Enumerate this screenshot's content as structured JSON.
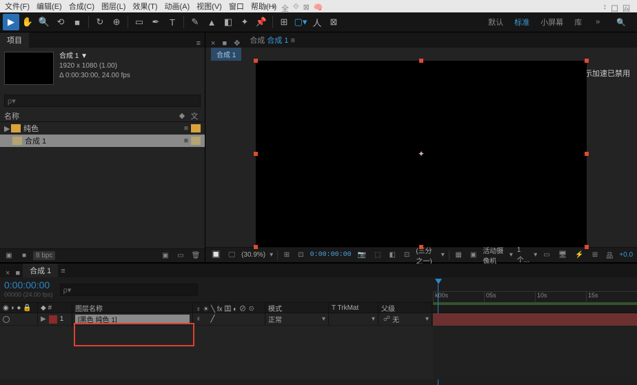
{
  "menu": {
    "file": "文件(F)",
    "edit": "编辑(E)",
    "composition": "合成(C)",
    "layer": "图层(L)",
    "effect": "效果(T)",
    "animation": "动画(A)",
    "view": "视图(V)",
    "window": "窗口",
    "help": "帮助(H)"
  },
  "workspace": {
    "default": "默认",
    "standard": "标准",
    "small": "小屏幕",
    "library": "库"
  },
  "project": {
    "tab": "项目",
    "item_name": "合成 1 ▼",
    "resolution": "1920 x 1080 (1.00)",
    "duration": "Δ 0:00:30:00, 24.00 fps",
    "search_placeholder": "ρ▾",
    "col_name": "名称",
    "folder_label": "纯色",
    "comp_label": "合成 1",
    "bpc": "8 bpc"
  },
  "viewer": {
    "tab_prefix": "合成",
    "tab_active": "合成 1",
    "subtab": "合成 1",
    "message": "显示加速已禁用",
    "zoom": "(30.9%)",
    "timecode": "0:00:00:00",
    "res_dd": "(三分之一)",
    "camera_dd": "活动摄像机",
    "views_dd": "1个...",
    "exposure": "+0.0"
  },
  "timeline": {
    "tab": "合成 1",
    "timecode": "0:00:00:00",
    "sub_timecode": "00000 (24.00 fps)",
    "search_placeholder": "ρ▾",
    "ticks": [
      "k00s",
      "05s",
      "10s",
      "15s"
    ],
    "col_layer_name": "图层名称",
    "col_switches": "♀ ☀ ╲ fx 囯 ◐ ⊘ ☉",
    "col_mode": "模式",
    "col_trkmat": "T  TrkMat",
    "col_parent": "父级",
    "row1": {
      "num": "1",
      "name": "[黑色 纯色 1]",
      "switch": "♀",
      "switch2": "╱",
      "mode": "正常",
      "trkmat": "",
      "parent": "无"
    }
  }
}
